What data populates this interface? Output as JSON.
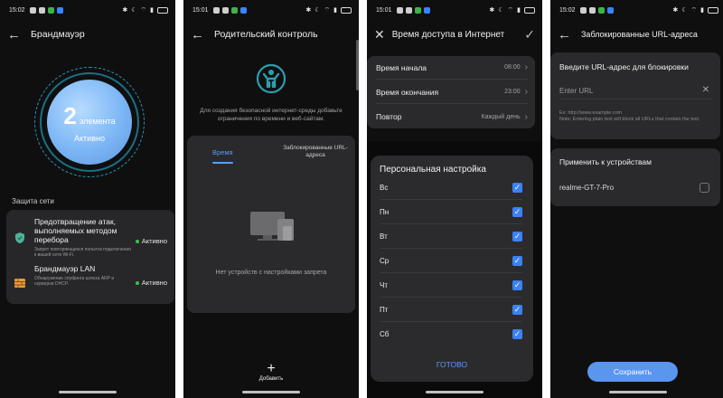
{
  "screens": [
    {
      "status": {
        "time": "15:02"
      },
      "header": {
        "title": "Брандмауэр"
      },
      "summary": {
        "count": "2",
        "unit": "элемента",
        "state": "Активно"
      },
      "section_label": "Защита сети",
      "items": [
        {
          "title": "Предотвращение атак, выполняемых методом перебора",
          "desc": "Запрет повторяющихся попыток подключения к вашей сети Wi-Fi.",
          "state": "Активно"
        },
        {
          "title": "Брандмауэр LAN",
          "desc": "Обнаружение спуфинга шлюза ARP и серверов DHCP.",
          "state": "Активно"
        }
      ]
    },
    {
      "status": {
        "time": "15:01"
      },
      "header": {
        "title": "Родительский контроль"
      },
      "description": "Для создания безопасной интернет-среды добавьте ограничения по времени и веб-сайтам.",
      "tabs": [
        {
          "label": "Время"
        },
        {
          "label": "Заблокированные URL-адреса"
        }
      ],
      "empty_text": "Нет устройств с настройками запрета",
      "add_label": "Добавить"
    },
    {
      "status": {
        "time": "15:01"
      },
      "header": {
        "title": "Время доступа в Интернет"
      },
      "rows": [
        {
          "label": "Время начала",
          "value": "08:00"
        },
        {
          "label": "Время окончания",
          "value": "23:00"
        },
        {
          "label": "Повтор",
          "value": "Каждый день"
        }
      ],
      "sheet": {
        "title": "Персональная настройка",
        "days": [
          "Вс",
          "Пн",
          "Вт",
          "Ср",
          "Чт",
          "Пт",
          "Сб"
        ],
        "done_label": "ГОТОВО"
      }
    },
    {
      "status": {
        "time": "15:02"
      },
      "header": {
        "title": "Заблокированные URL-адреса"
      },
      "url_card": {
        "title": "Введите URL-адрес для блокировки",
        "placeholder": "Enter URL",
        "hint": "Ex: http://www.example.com\nNote: Entering plain text will block all URLs that contain the text."
      },
      "apply_card": {
        "title": "Применить к устройствам",
        "device": "realme-GT-7-Pro"
      },
      "save_label": "Сохранить"
    }
  ]
}
